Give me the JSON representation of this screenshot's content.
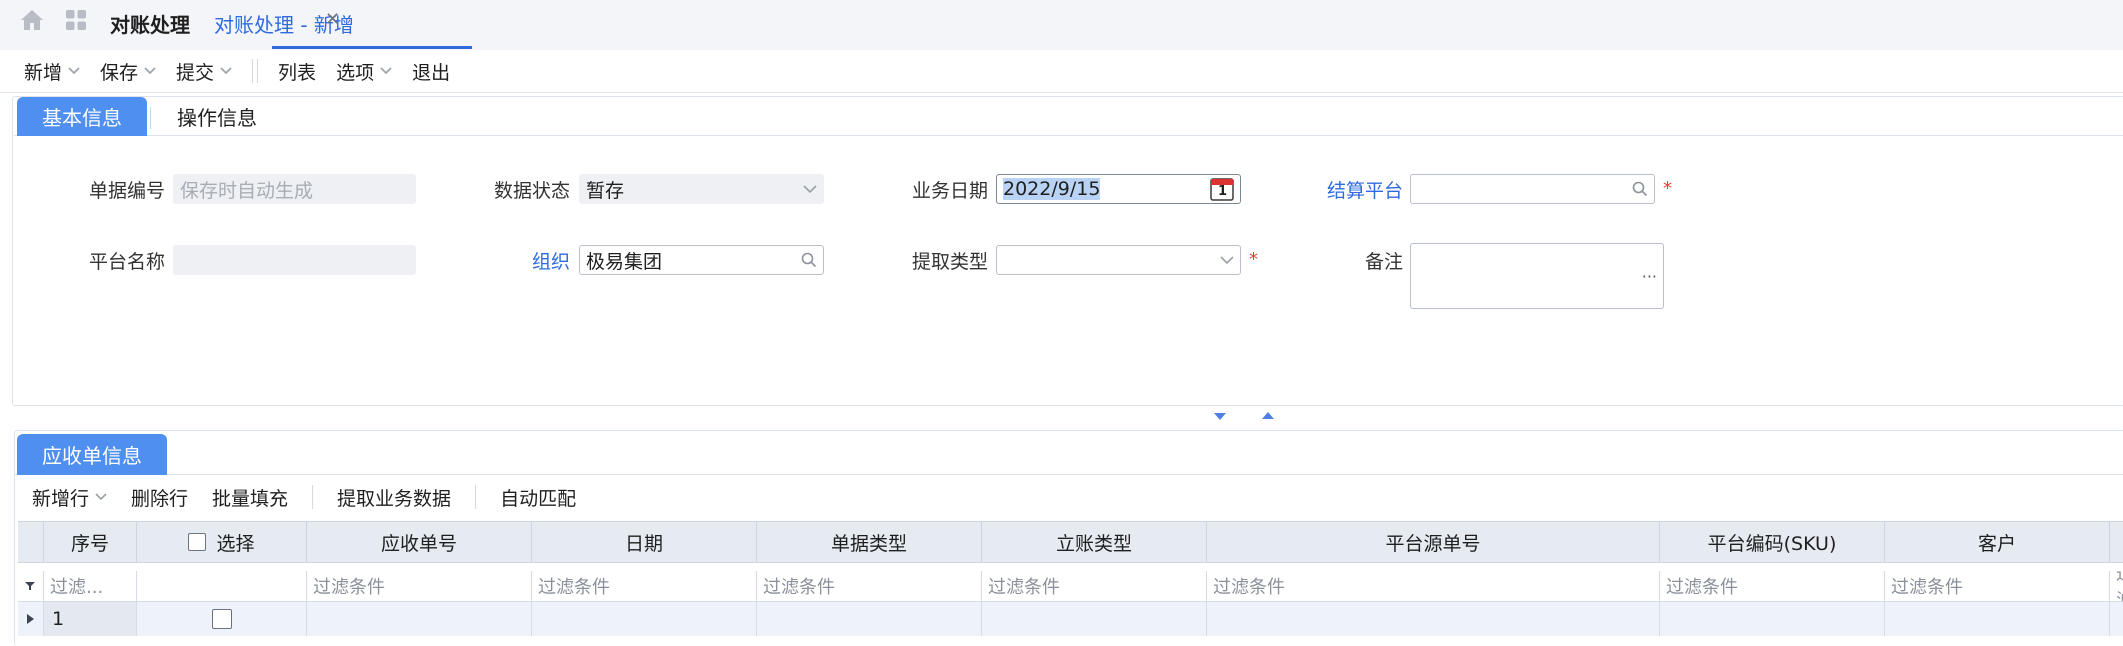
{
  "tabs": {
    "home_icon": "home-icon",
    "apps_icon": "grid-icon",
    "items": [
      {
        "label": "对账处理"
      },
      {
        "label": "对账处理 - 新增",
        "close": "✕"
      }
    ]
  },
  "toolbar": {
    "new": "新增",
    "save": "保存",
    "submit": "提交",
    "list": "列表",
    "options": "选项",
    "exit": "退出"
  },
  "basic_section": {
    "tabs": [
      "基本信息",
      "操作信息"
    ],
    "fields": {
      "doc_no": {
        "label": "单据编号",
        "placeholder": "保存时自动生成",
        "value": ""
      },
      "status": {
        "label": "数据状态",
        "value": "暂存"
      },
      "biz_date": {
        "label": "业务日期",
        "value": "2022/9/15",
        "calendar_day": "1"
      },
      "platform": {
        "label": "结算平台",
        "value": "",
        "required": "*"
      },
      "platform_name": {
        "label": "平台名称",
        "value": ""
      },
      "org": {
        "label": "组织",
        "value": "极易集团"
      },
      "extract_type": {
        "label": "提取类型",
        "value": "",
        "required": "*"
      },
      "remark": {
        "label": "备注",
        "value": "",
        "more": "···"
      }
    }
  },
  "receivable_section": {
    "tab": "应收单信息",
    "toolbar": {
      "add_row": "新增行",
      "delete_row": "删除行",
      "batch_fill": "批量填充",
      "extract_data": "提取业务数据",
      "auto_match": "自动匹配"
    },
    "columns": [
      "序号",
      "选择",
      "应收单号",
      "日期",
      "单据类型",
      "立账类型",
      "平台源单号",
      "平台编码(SKU)",
      "客户"
    ],
    "filter_placeholder": "过滤条件",
    "filter_seq": "过滤...",
    "filter_last": "过滤",
    "rows": [
      {
        "seq": "1"
      }
    ]
  },
  "colors": {
    "accent": "#2f6bde",
    "tab_fill": "#4f8ff0",
    "required": "#e33a3a"
  }
}
